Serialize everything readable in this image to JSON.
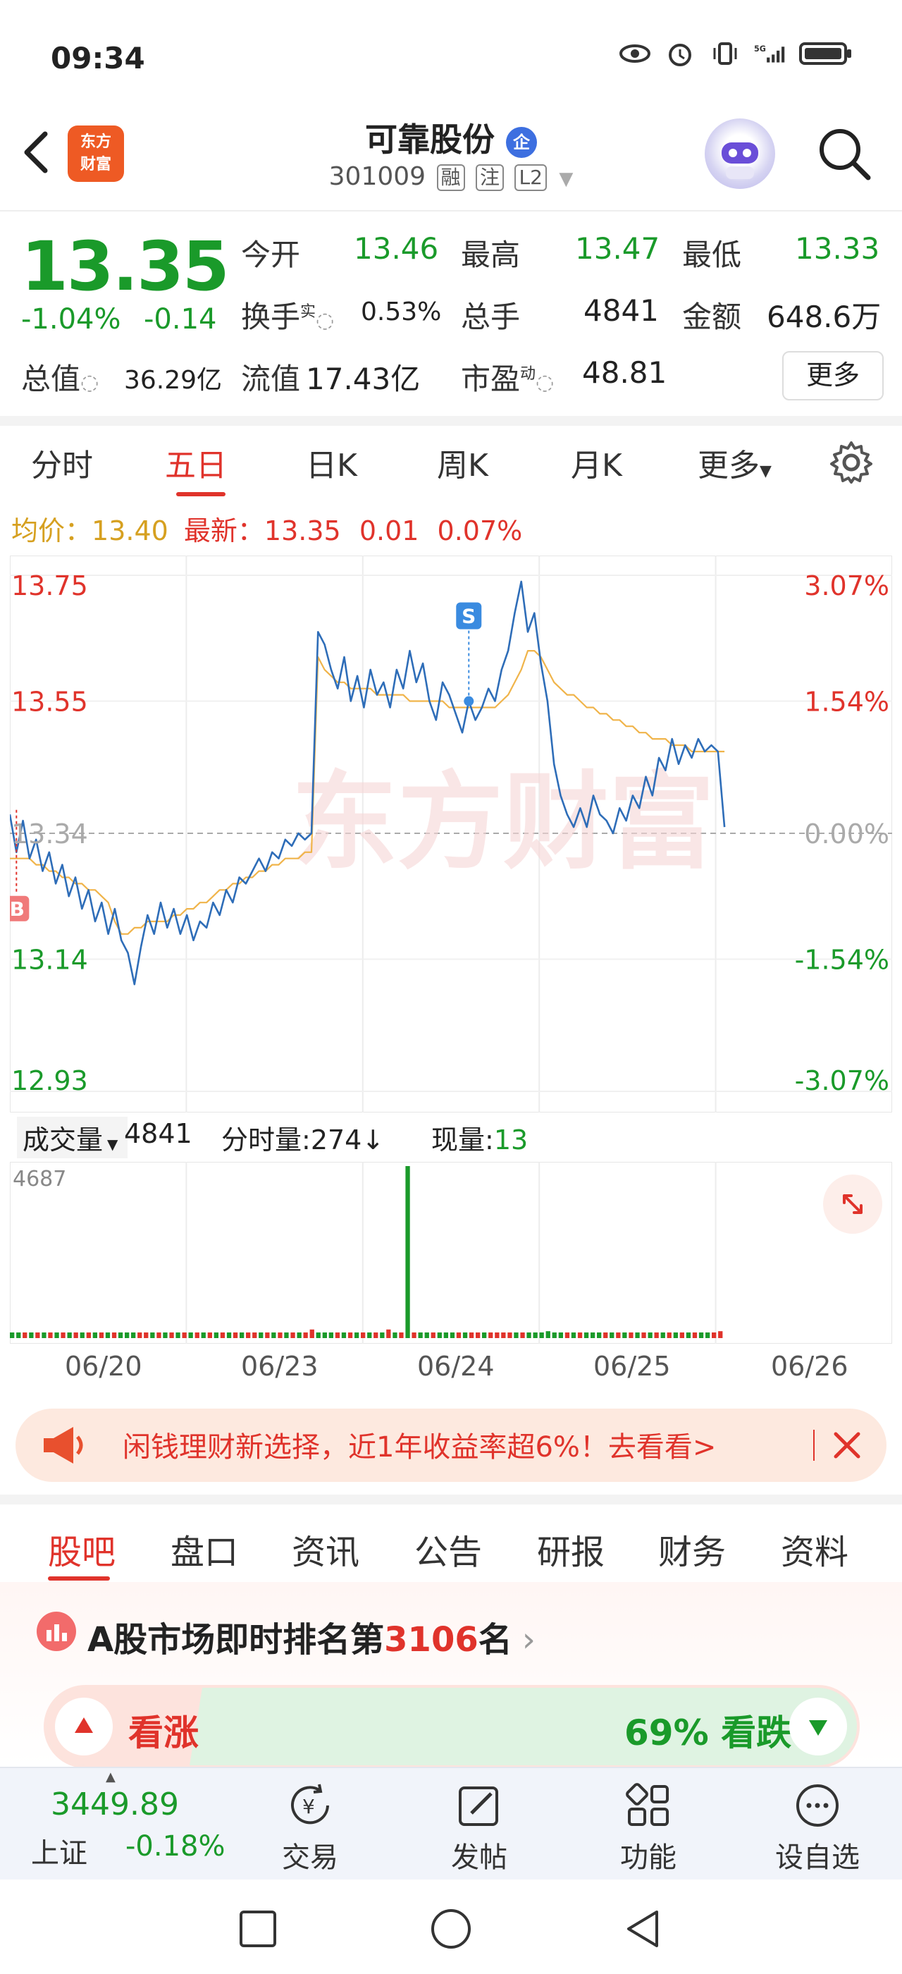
{
  "status_bar": {
    "time": "09:34",
    "icons": [
      "eye-icon",
      "alarm-icon",
      "vibrate-icon",
      "5g-signal-icon",
      "battery-icon"
    ],
    "network": "5G"
  },
  "header": {
    "back_icon": "back-arrow-icon",
    "logo_line1": "东方",
    "logo_line2": "财富",
    "stock_name": "可靠股份",
    "name_badge": "企",
    "stock_code": "301009",
    "tags": [
      "融",
      "注",
      "L2"
    ]
  },
  "quote": {
    "price": "13.35",
    "change_pct": "-1.04%",
    "change_amt": "-0.14",
    "fields": [
      {
        "label": "今开",
        "value": "13.46"
      },
      {
        "label": "最高",
        "value": "13.47"
      },
      {
        "label": "最低",
        "value": "13.33"
      },
      {
        "label": "换手",
        "sup": "实",
        "value": "0.53%"
      },
      {
        "label": "总手",
        "value": "4841"
      },
      {
        "label": "金额",
        "value": "648.6万"
      },
      {
        "label": "总值",
        "value": "36.29亿"
      },
      {
        "label": "流值",
        "value": "17.43亿"
      },
      {
        "label": "市盈",
        "sup": "动",
        "value": "48.81"
      }
    ],
    "more_label": "更多"
  },
  "chart_tabs": {
    "items": [
      "分时",
      "五日",
      "日K",
      "周K",
      "月K",
      "更多"
    ],
    "active": "五日"
  },
  "info_row": {
    "avg_label": "均价：",
    "avg_value": "13.40",
    "latest_label": "最新：",
    "latest_value": "13.35",
    "latest_change": "0.01",
    "latest_pct": "0.07%"
  },
  "chart_data": {
    "type": "line",
    "ylim": [
      12.93,
      13.75
    ],
    "y_ticks_left": [
      "13.75",
      "13.55",
      "13.34",
      "13.14",
      "12.93"
    ],
    "y_ticks_right": [
      "3.07%",
      "1.54%",
      "0.00%",
      "-1.54%",
      "-3.07%"
    ],
    "x_categories": [
      "06/20",
      "06/23",
      "06/24",
      "06/25",
      "06/26"
    ],
    "prev_close": 13.34,
    "watermark": "东方财富",
    "markers": [
      {
        "label": "B"
      },
      {
        "label": "S"
      }
    ],
    "series": [
      {
        "values": [
          13.37,
          13.31,
          13.36,
          13.3,
          13.33,
          13.28,
          13.31,
          13.26,
          13.29,
          13.24,
          13.27,
          13.22,
          13.25,
          13.2,
          13.23,
          13.18,
          13.22,
          13.17,
          13.15,
          13.1,
          13.16,
          13.21,
          13.18,
          13.23,
          13.19,
          13.22,
          13.18,
          13.21,
          13.17,
          13.2,
          13.19,
          13.23,
          13.21,
          13.25,
          13.23,
          13.27,
          13.26,
          13.28,
          13.3,
          13.28,
          13.31,
          13.3,
          13.33,
          13.32,
          13.34,
          13.33,
          13.34,
          13.66,
          13.64,
          13.6,
          13.57,
          13.62,
          13.55,
          13.59,
          13.54,
          13.6,
          13.56,
          13.58,
          13.54,
          13.6,
          13.57,
          13.63,
          13.58,
          13.61,
          13.55,
          13.52,
          13.58,
          13.56,
          13.53,
          13.5,
          13.55,
          13.52,
          13.54,
          13.57,
          13.55,
          13.6,
          13.63,
          13.69,
          13.74,
          13.66,
          13.69,
          13.61,
          13.55,
          13.45,
          13.4,
          13.37,
          13.35,
          13.38,
          13.35,
          13.4,
          13.37,
          13.36,
          13.34,
          13.38,
          13.36,
          13.4,
          13.38,
          13.43,
          13.4,
          13.46,
          13.44,
          13.49,
          13.45,
          13.48,
          13.46,
          13.49,
          13.47,
          13.48,
          13.47,
          13.35
        ]
      },
      {
        "values": [
          13.3,
          13.3,
          13.3,
          13.3,
          13.29,
          13.29,
          13.28,
          13.28,
          13.27,
          13.27,
          13.26,
          13.26,
          13.25,
          13.25,
          13.24,
          13.23,
          13.2,
          13.18,
          13.18,
          13.19,
          13.19,
          13.2,
          13.2,
          13.2,
          13.2,
          13.21,
          13.21,
          13.22,
          13.22,
          13.23,
          13.23,
          13.24,
          13.25,
          13.25,
          13.26,
          13.26,
          13.27,
          13.27,
          13.28,
          13.28,
          13.29,
          13.29,
          13.3,
          13.3,
          13.3,
          13.31,
          13.31,
          13.62,
          13.6,
          13.59,
          13.58,
          13.58,
          13.57,
          13.57,
          13.57,
          13.57,
          13.56,
          13.56,
          13.56,
          13.56,
          13.56,
          13.55,
          13.55,
          13.55,
          13.55,
          13.55,
          13.55,
          13.54,
          13.54,
          13.54,
          13.54,
          13.54,
          13.54,
          13.54,
          13.54,
          13.55,
          13.56,
          13.58,
          13.6,
          13.63,
          13.63,
          13.62,
          13.6,
          13.58,
          13.57,
          13.56,
          13.56,
          13.55,
          13.54,
          13.54,
          13.53,
          13.53,
          13.52,
          13.52,
          13.51,
          13.51,
          13.5,
          13.5,
          13.49,
          13.49,
          13.49,
          13.48,
          13.48,
          13.48,
          13.47,
          13.47,
          13.47,
          13.47,
          13.47,
          13.47
        ]
      }
    ]
  },
  "volume": {
    "selector_label": "成交量",
    "selector_value": "4841",
    "minute_label": "分时量:",
    "minute_value": "274",
    "current_label": "现量:",
    "current_value": "13",
    "max_label": "4687",
    "expand_icon": "expand-icon"
  },
  "volume_data": {
    "type": "bar",
    "ymax": 4687,
    "values": [
      3,
      1,
      2,
      1,
      1,
      2,
      1,
      1,
      1,
      2,
      1,
      1,
      1,
      2,
      1,
      1,
      1,
      1,
      1,
      2,
      3,
      1,
      1,
      1,
      2,
      1,
      1,
      1,
      2,
      1,
      1,
      3,
      1,
      1,
      2,
      1,
      1,
      1,
      2,
      1,
      1,
      1,
      1,
      2,
      1,
      1,
      1,
      5,
      2,
      3,
      2,
      1,
      2,
      1,
      1,
      2,
      1,
      2,
      1,
      5,
      1,
      2,
      100,
      2,
      1,
      1,
      2,
      3,
      1,
      2,
      1,
      1,
      2,
      1,
      2,
      1,
      1,
      3,
      2,
      1,
      1,
      3,
      2,
      1,
      4,
      2,
      3,
      1,
      1,
      2,
      1,
      1,
      2,
      3,
      1,
      1,
      2,
      1,
      1,
      2,
      1,
      1,
      2,
      1,
      1,
      1,
      2,
      1,
      1,
      1,
      2,
      4
    ],
    "scale_note": "relative"
  },
  "promo": {
    "icon": "megaphone-icon",
    "text": "闲钱理财新选择，近1年收益率超6%！去看看>",
    "close_icon": "close-icon"
  },
  "section_tabs": {
    "items": [
      "股吧",
      "盘口",
      "资讯",
      "公告",
      "研报",
      "财务",
      "资料"
    ],
    "active": "股吧"
  },
  "ranking": {
    "prefix": "A股市场即时排名第",
    "rank": "3106",
    "suffix": "名"
  },
  "vote": {
    "up_label": "看涨",
    "down_label": "69% 看跌",
    "down_pct": 69
  },
  "bottom_bar": {
    "index_value": "3449.89",
    "index_name": "上证",
    "index_change": "-0.18%",
    "nav": [
      {
        "label": "交易",
        "icon": "yen-trade-icon"
      },
      {
        "label": "发帖",
        "icon": "edit-post-icon"
      },
      {
        "label": "功能",
        "icon": "grid-function-icon"
      },
      {
        "label": "设自选",
        "icon": "more-dots-icon"
      }
    ]
  },
  "system_nav": [
    "recent-apps-icon",
    "home-icon",
    "back-icon"
  ]
}
